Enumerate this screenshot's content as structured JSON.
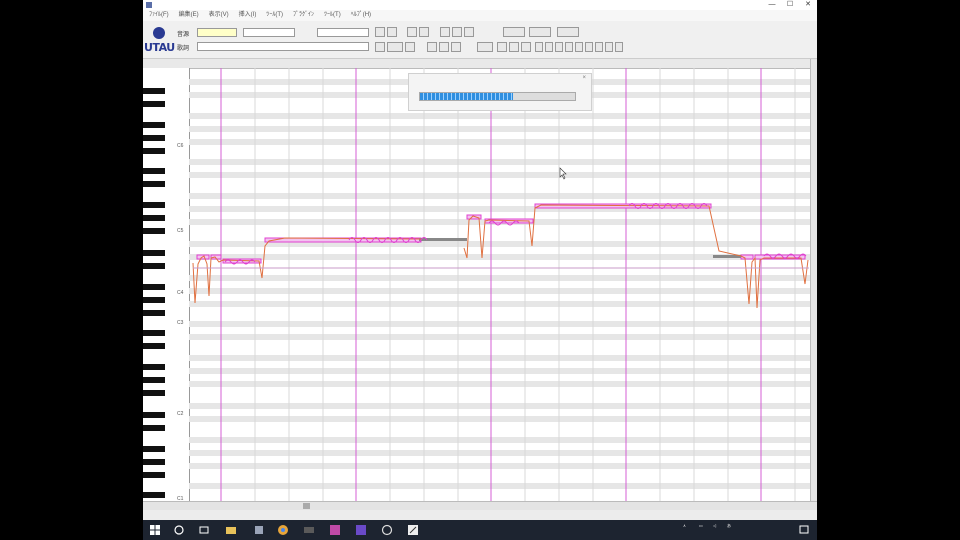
{
  "window": {
    "title": "",
    "controls": [
      "—",
      "☐",
      "✕"
    ]
  },
  "menu": [
    "ﾌｧｲﾙ(F)",
    "編集(E)",
    "表示(V)",
    "挿入(I)",
    "ﾂｰﾙ(T)",
    "ﾌﾟﾗｸﾞｲﾝ",
    "ﾂｰﾙ(T)",
    "ﾍﾙﾌﾟ(H)"
  ],
  "toolbar": {
    "logo_text": "UTAU",
    "row1_label": "音源",
    "row2_label": "歌詞",
    "voice_field": "",
    "resampler_field": "",
    "wavtool_field": "",
    "tempo_label": "",
    "buttons": [
      "",
      "",
      "",
      "",
      "",
      "",
      "",
      ""
    ]
  },
  "ruler": {
    "labels": [
      "",
      "",
      "",
      "",
      "",
      ""
    ]
  },
  "piano": {
    "octaves": [
      "C6",
      "C5",
      "C4",
      "C3",
      "C2",
      "C1"
    ]
  },
  "progress": {
    "title": "",
    "close": "×",
    "value": 0.6
  },
  "status": {
    "left": "",
    "middle": ""
  },
  "taskbar": {
    "icons": [
      "windows-start-icon",
      "search-icon",
      "task-view-icon",
      "folder-icon",
      "app-icon",
      "chrome-icon",
      "media-icon",
      "utau-icon",
      "app-icon",
      "circle-icon",
      "pen-icon"
    ],
    "tray_time": "",
    "tray_date": ""
  },
  "colors": {
    "note_pink": "#e040d0",
    "pitch_curve": "#e07040",
    "grid_row": "#e6e6e6",
    "bar_line": "#d45fd4",
    "progress_blue": "#2f8fe0"
  }
}
